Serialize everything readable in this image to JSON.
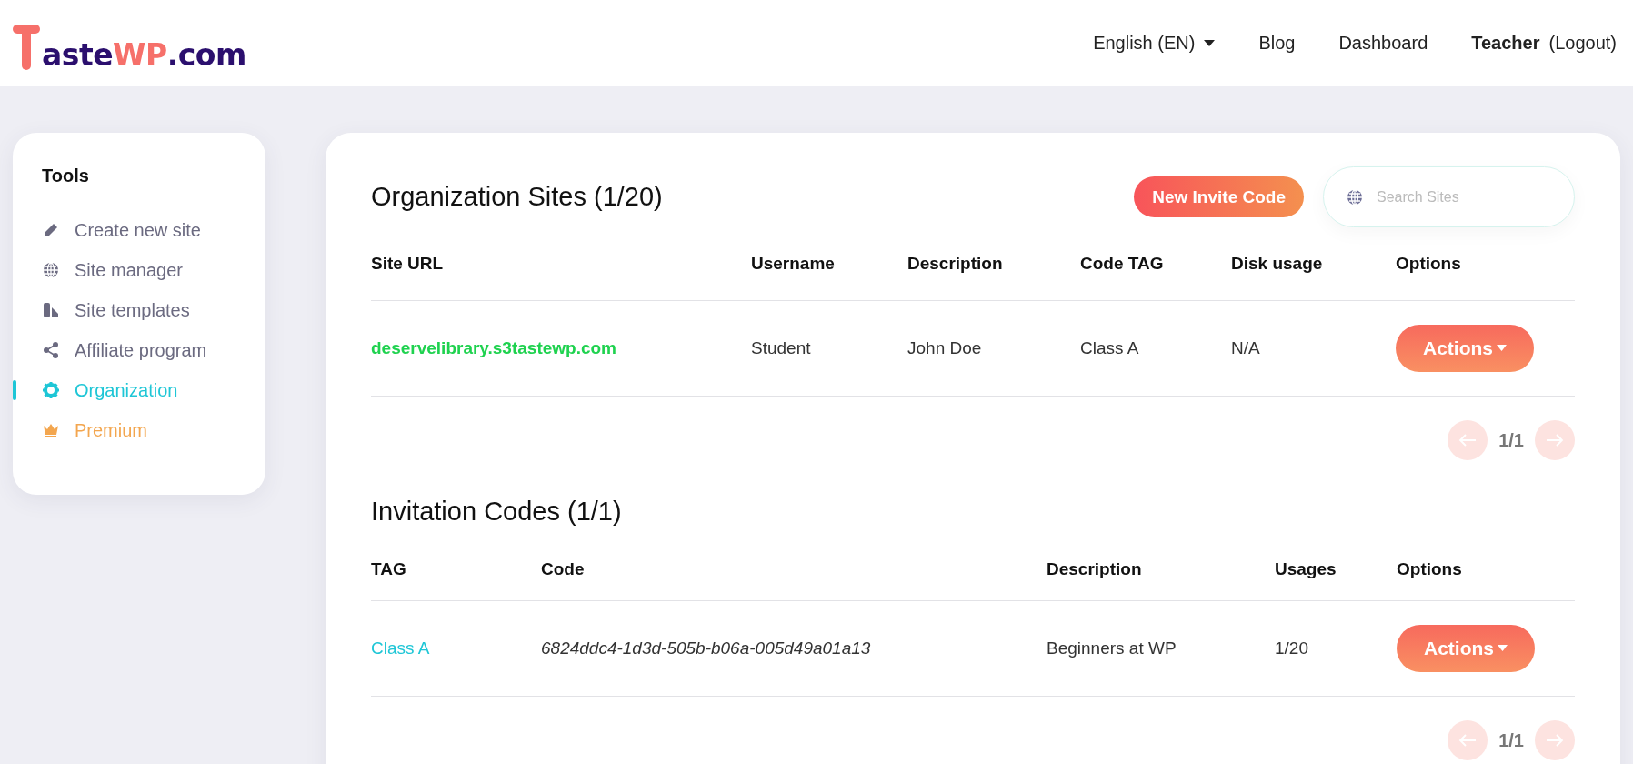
{
  "header": {
    "logo": {
      "main": "aste",
      "accent": "WP",
      "tail": ".com"
    },
    "nav": [
      {
        "label": "English (EN)",
        "kind": "dropdown"
      },
      {
        "label": "Blog",
        "kind": "link"
      },
      {
        "label": "Dashboard",
        "kind": "link"
      },
      {
        "label": "**Teacher** (Logout)",
        "kind": "link"
      }
    ]
  },
  "sidebar": {
    "title": "Tools",
    "items": [
      {
        "label": "Create new site",
        "selected": false,
        "kind": "normal"
      },
      {
        "label": "Site manager",
        "selected": false,
        "kind": "normal"
      },
      {
        "label": "Site templates",
        "selected": false,
        "kind": "normal"
      },
      {
        "label": "Affiliate program",
        "selected": false,
        "kind": "normal"
      },
      {
        "label": "Organization",
        "selected": true,
        "kind": "normal"
      },
      {
        "label": "Premium",
        "selected": false,
        "kind": "premium"
      }
    ]
  },
  "sites": {
    "title": "Organization Sites (1/20)",
    "new_button": "New Invite Code",
    "search": {
      "placeholder": "Search Sites"
    },
    "columns": [
      "Site URL",
      "Username",
      "Description",
      "Code TAG",
      "Disk usage",
      "Options"
    ],
    "rows": [
      {
        "site_url": "deservelibrary.s3tastewp.com",
        "username": "Student",
        "description": "John Doe",
        "code_tag": "Class A",
        "disk_usage": "N/A",
        "action": "Actions"
      }
    ],
    "pagination": {
      "page": "1/1",
      "prev_disabled": true,
      "next_disabled": true
    }
  },
  "codes": {
    "title": "Invitation Codes (1/1)",
    "columns": [
      "TAG",
      "Code",
      "Description",
      "Usages",
      "Options"
    ],
    "rows": [
      {
        "tag": "Class A",
        "code": "6824ddc4-1d3d-505b-b06a-005d49a01a13",
        "description": "Beginners at WP",
        "usages": "1/20",
        "action": "Actions"
      }
    ],
    "pagination": {
      "page": "1/1",
      "prev_disabled": true,
      "next_disabled": true
    }
  }
}
